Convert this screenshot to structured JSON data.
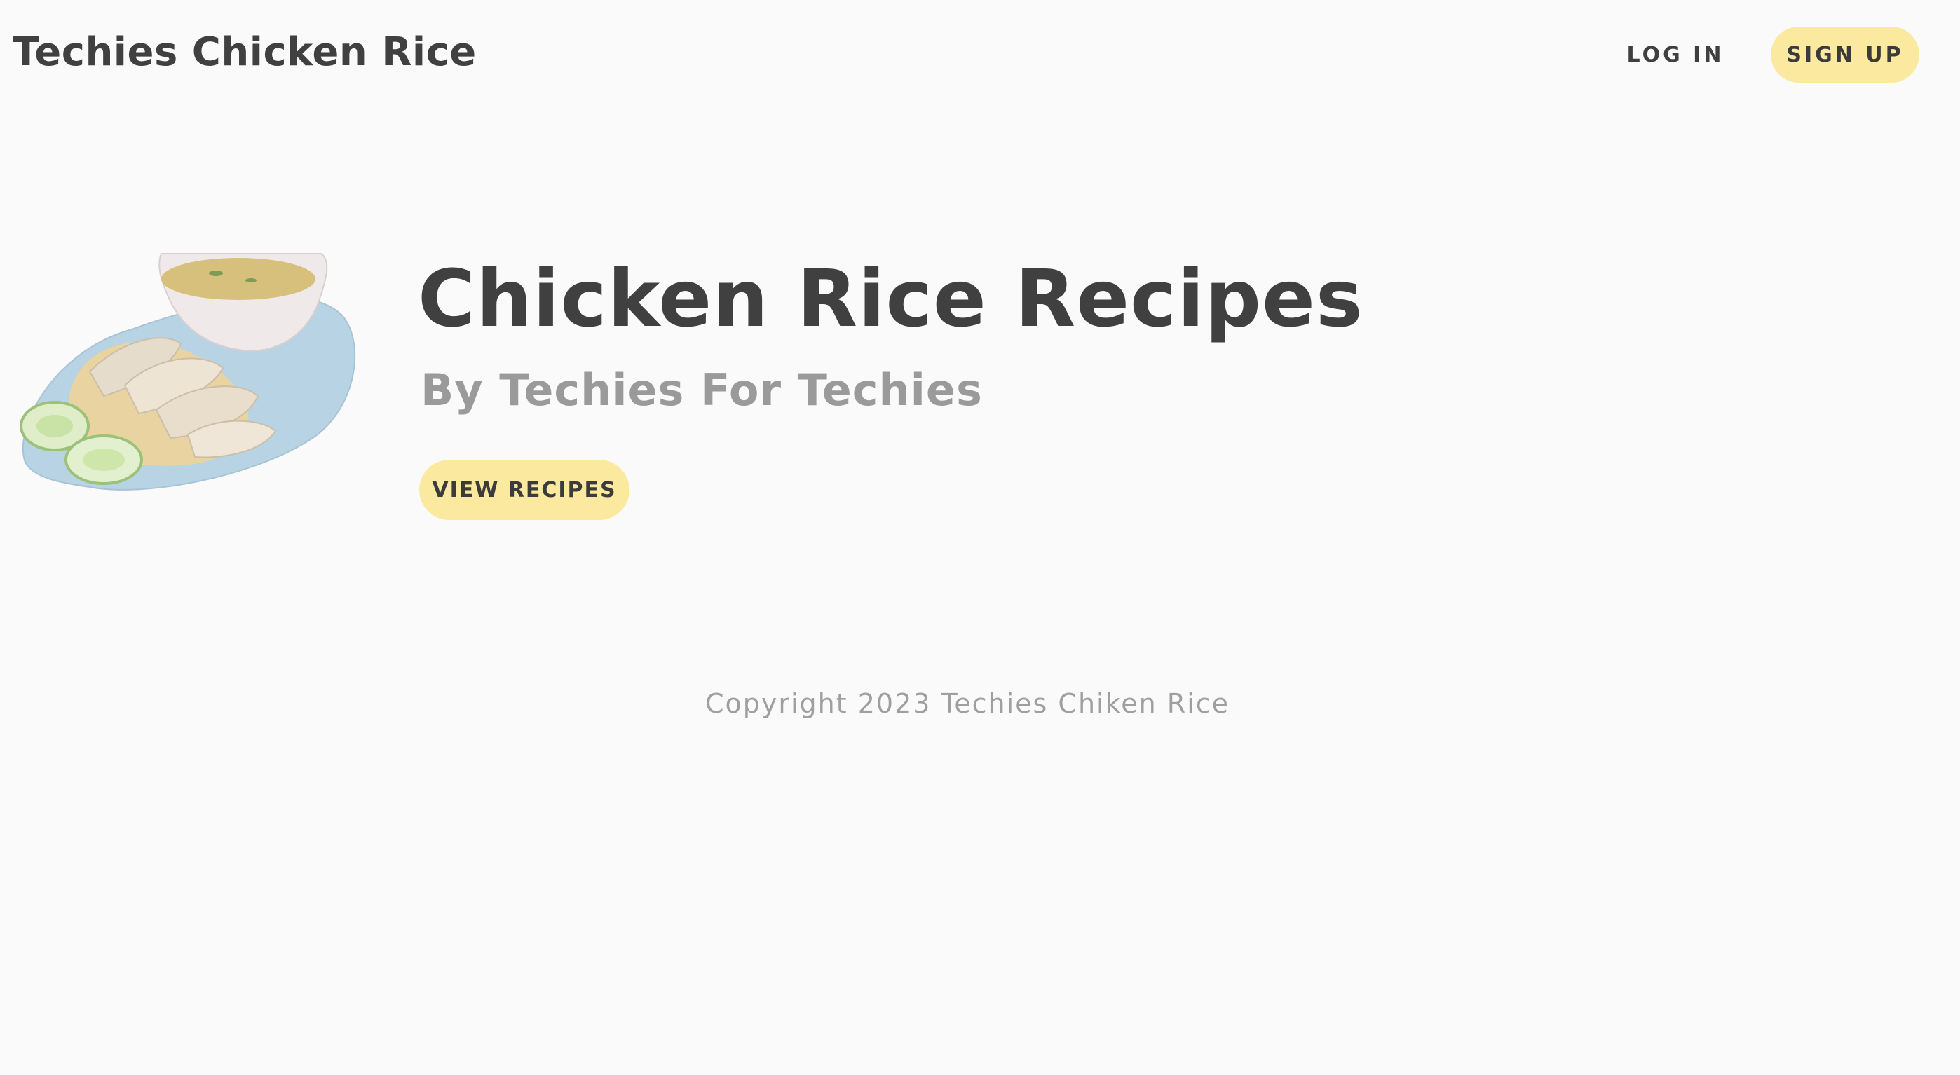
{
  "header": {
    "brand": "Techies Chicken Rice",
    "login_label": "LOG IN",
    "signup_label": "SIGN UP",
    "signup_bg": "#fbe9a0"
  },
  "hero": {
    "image_icon": "chicken-rice-plate-image",
    "title": "Chicken Rice Recipes",
    "subtitle": "By Techies For Techies",
    "button_label": "VIEW RECIPES",
    "button_bg": "#fbe9a0"
  },
  "footer": {
    "copyright": "Copyright 2023 Techies Chiken Rice"
  }
}
